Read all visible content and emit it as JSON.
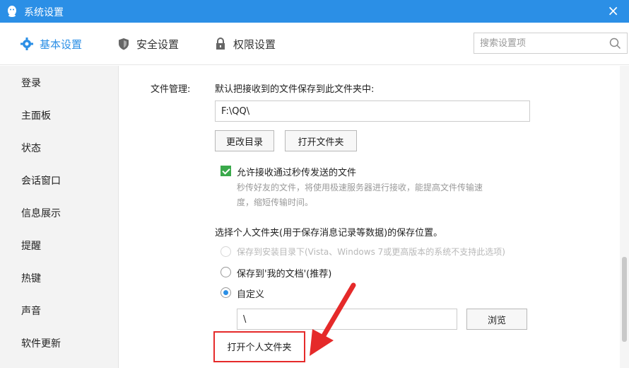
{
  "window": {
    "title": "系统设置"
  },
  "tabs": [
    {
      "label": "基本设置",
      "icon": "gear-icon",
      "active": true
    },
    {
      "label": "安全设置",
      "icon": "shield-icon",
      "active": false
    },
    {
      "label": "权限设置",
      "icon": "lock-icon",
      "active": false
    }
  ],
  "search": {
    "placeholder": "搜索设置项"
  },
  "sidebar": {
    "items": [
      {
        "label": "登录"
      },
      {
        "label": "主面板"
      },
      {
        "label": "状态"
      },
      {
        "label": "会话窗口"
      },
      {
        "label": "信息展示"
      },
      {
        "label": "提醒"
      },
      {
        "label": "热键"
      },
      {
        "label": "声音"
      },
      {
        "label": "软件更新"
      }
    ]
  },
  "file_management": {
    "label": "文件管理:",
    "desc": "默认把接收到的文件保存到此文件夹中:",
    "path_value": "F:\\QQ\\",
    "change_dir_button": "更改目录",
    "open_folder_button": "打开文件夹",
    "allow_receive_checkbox": "允许接收通过秒传发送的文件",
    "allow_receive_desc_line1": "秒传好友的文件，将使用极速服务器进行接收，能提高文件传输速",
    "allow_receive_desc_line2": "度，缩短传输时间。"
  },
  "personal_folder": {
    "title": "选择个人文件夹(用于保存消息记录等数据)的保存位置。",
    "option_install_dir": "保存到安装目录下(Vista、Windows 7或更高版本的系统不支持此选项)",
    "option_my_documents": "保存到'我的文档'(推荐)",
    "option_custom": "自定义",
    "custom_path_value": "\\",
    "browse_button": "浏览",
    "open_personal_folder_button": "打开个人文件夹"
  },
  "colors": {
    "accent": "#2b8fe6",
    "highlight": "#e52a2a",
    "check": "#3aa94b"
  }
}
